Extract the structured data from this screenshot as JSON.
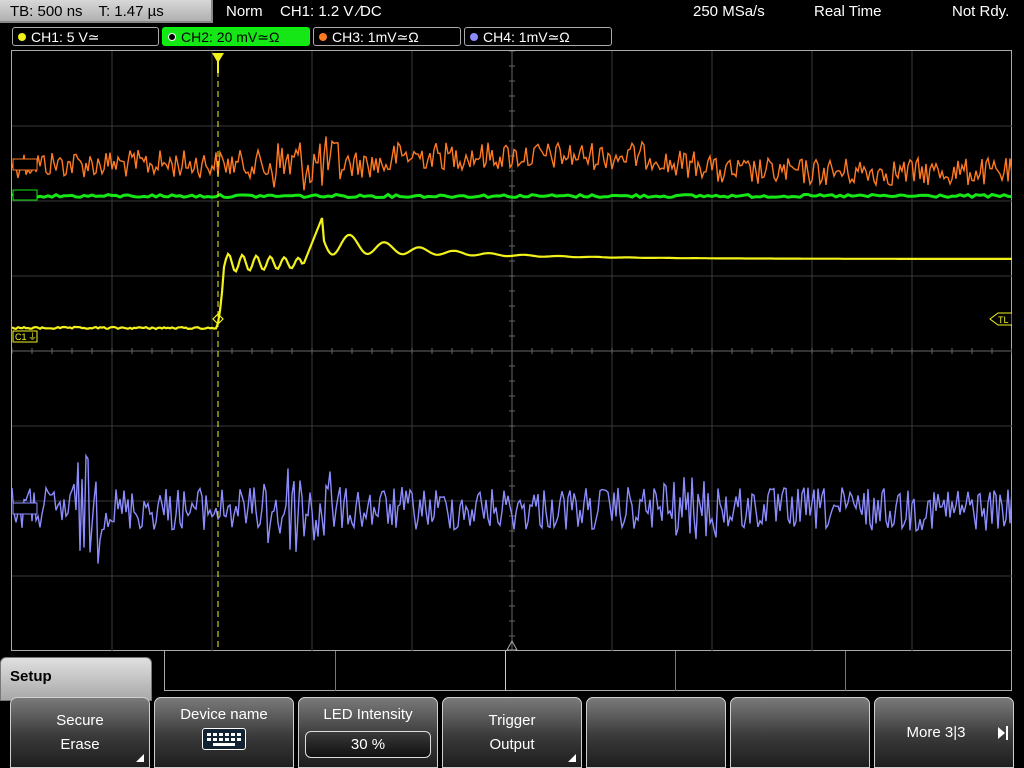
{
  "topbar": {
    "timebase": "TB: 500 ns",
    "trigger_time": "T: 1.47 µs",
    "mode": "Norm",
    "trigger_info": "CH1: 1.2 V ∕DC",
    "sample_rate": "250 MSa/s",
    "acq_mode": "Real Time",
    "status": "Not Rdy."
  },
  "channels": [
    {
      "label": "CH1: 5 V≃",
      "color": "#f2f21a",
      "active": false
    },
    {
      "label": "CH2: 20 mV≃Ω",
      "color": "#15e615",
      "active": true
    },
    {
      "label": "CH3: 1mV≃Ω",
      "color": "#ff7a22",
      "active": false
    },
    {
      "label": "CH4: 1mV≃Ω",
      "color": "#8c8cff",
      "active": false
    }
  ],
  "markers": {
    "ch1_ref": "C1",
    "trigger_level": "TL"
  },
  "menu": {
    "title": "Setup",
    "softkeys": [
      {
        "line1": "Secure",
        "line2": "Erase"
      },
      {
        "line1": "Device name",
        "icon": "keyboard-icon"
      },
      {
        "line1": "LED Intensity",
        "value": "30 %"
      },
      {
        "line1": "Trigger",
        "line2": "Output"
      },
      {
        "line1": "",
        "line2": ""
      },
      {
        "line1": "",
        "line2": ""
      },
      {
        "line1": "More 3|3"
      }
    ]
  }
}
